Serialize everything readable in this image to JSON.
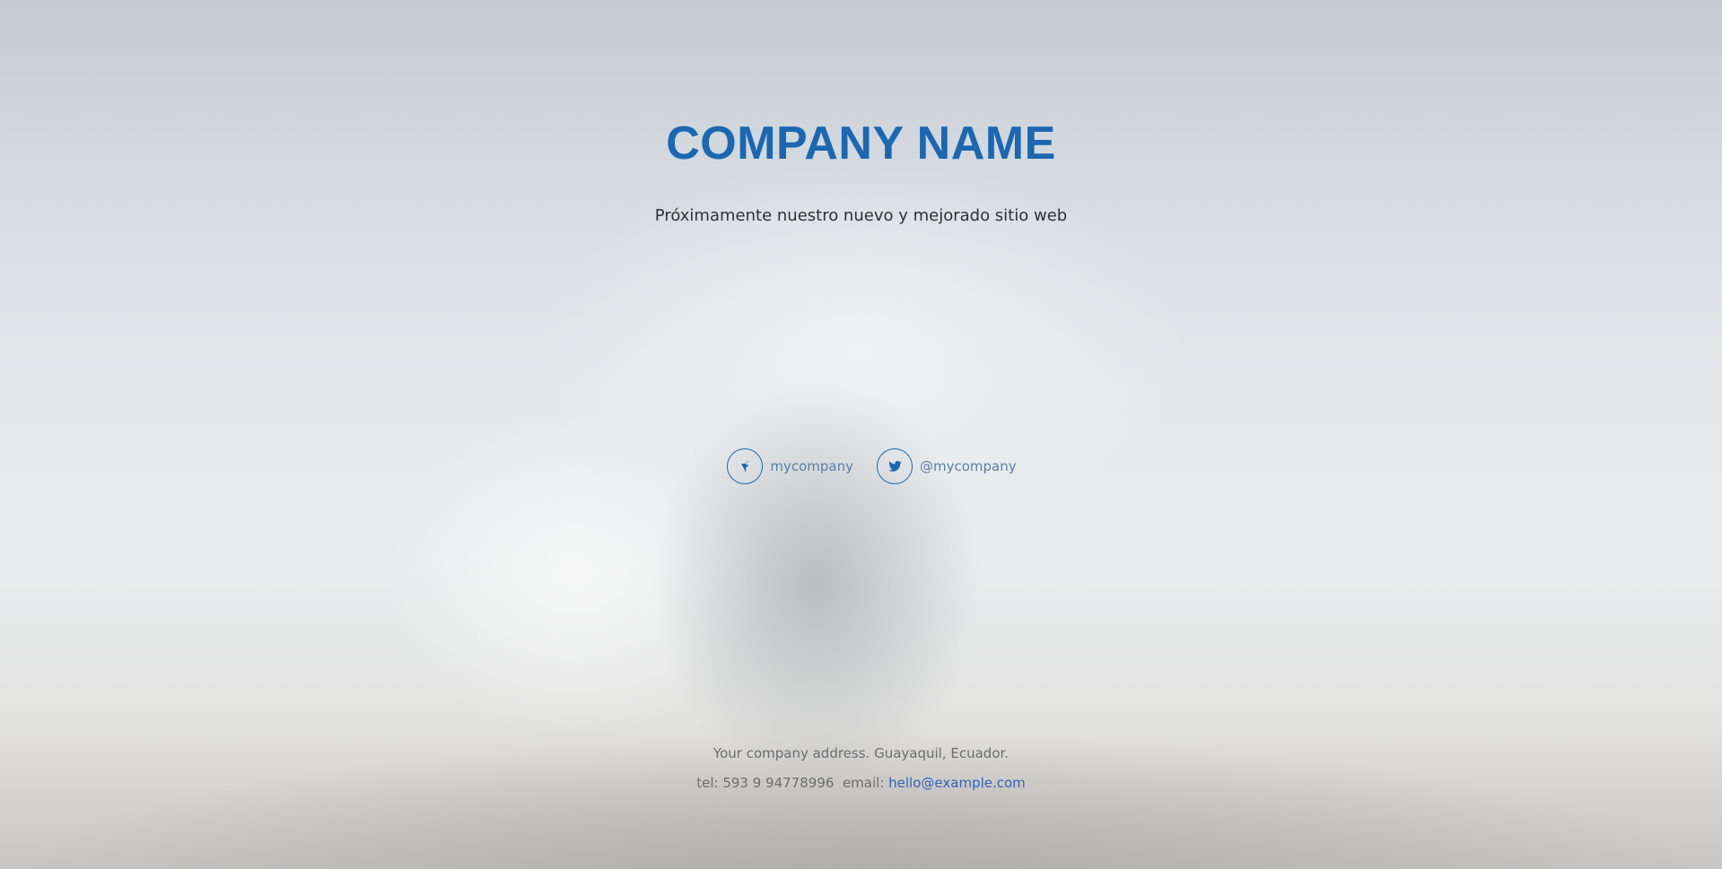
{
  "hero": {
    "title": "COMPANY NAME",
    "subtitle": "Próximamente nuestro nuevo y mejorado sitio web"
  },
  "social": [
    {
      "icon": "facebook-icon",
      "label": "mycompany"
    },
    {
      "icon": "twitter-icon",
      "label": "@mycompany"
    }
  ],
  "footer": {
    "address": "Your company address. Guayaquil, Ecuador.",
    "phone_label": "tel:",
    "phone": "593 9 94778996",
    "email_label": "email:",
    "email": "hello@example.com"
  },
  "colors": {
    "accent": "#1b67b1",
    "link": "#2f63b4",
    "text": "#2d3134",
    "muted": "#6a6d70"
  }
}
